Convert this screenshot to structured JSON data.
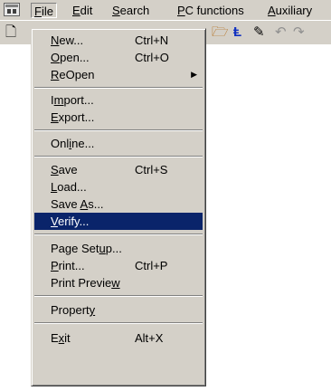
{
  "menubar": {
    "items": [
      {
        "label": "File",
        "accel": "F",
        "rest": "ile"
      },
      {
        "label": "Edit",
        "accel": "E",
        "rest": "dit"
      },
      {
        "label": "Search",
        "accel": "S",
        "rest": "earch"
      },
      {
        "label": "PC functions",
        "accel": "P",
        "rest": "C functions"
      },
      {
        "label": "Auxiliary",
        "accel": "A",
        "rest": "uxiliary"
      }
    ]
  },
  "toolbar": {
    "icons": [
      "new-document-icon",
      "folder-icon",
      "ladder-icon",
      "edit-icon",
      "undo-icon",
      "redo-icon"
    ]
  },
  "file_menu": {
    "new": {
      "pre": "",
      "accel": "N",
      "post": "ew...",
      "shortcut": "Ctrl+N"
    },
    "open": {
      "pre": "",
      "accel": "O",
      "post": "pen...",
      "shortcut": "Ctrl+O"
    },
    "reopen": {
      "pre": "",
      "accel": "R",
      "post": "eOpen"
    },
    "import": {
      "pre": "I",
      "accel": "m",
      "post": "port..."
    },
    "export": {
      "pre": "",
      "accel": "E",
      "post": "xport..."
    },
    "online": {
      "pre": "Onl",
      "accel": "i",
      "post": "ne..."
    },
    "save": {
      "pre": "",
      "accel": "S",
      "post": "ave",
      "shortcut": "Ctrl+S"
    },
    "load": {
      "pre": "",
      "accel": "L",
      "post": "oad..."
    },
    "save_as": {
      "pre": "Save ",
      "accel": "A",
      "post": "s..."
    },
    "verify": {
      "pre": "",
      "accel": "V",
      "post": "erify..."
    },
    "page_setup": {
      "pre": "Page Set",
      "accel": "u",
      "post": "p..."
    },
    "print": {
      "pre": "",
      "accel": "P",
      "post": "rint...",
      "shortcut": "Ctrl+P"
    },
    "print_preview": {
      "pre": "Print Previe",
      "accel": "w",
      "post": ""
    },
    "property": {
      "pre": "Propert",
      "accel": "y",
      "post": ""
    },
    "exit": {
      "pre": "E",
      "accel": "x",
      "post": "it",
      "shortcut": "Alt+X"
    }
  }
}
